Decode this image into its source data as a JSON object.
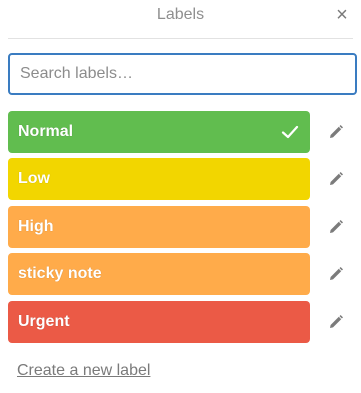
{
  "header": {
    "title": "Labels",
    "close_glyph": "×"
  },
  "search": {
    "placeholder": "Search labels…",
    "value": ""
  },
  "labels": [
    {
      "name": "Normal",
      "color": "#61bd4f",
      "selected": true
    },
    {
      "name": "Low",
      "color": "#f2d600",
      "selected": false
    },
    {
      "name": "High",
      "color": "#ffab4a",
      "selected": false
    },
    {
      "name": "sticky note",
      "color": "#ffab4a",
      "selected": false
    },
    {
      "name": "Urgent",
      "color": "#eb5a46",
      "selected": false
    }
  ],
  "icons": {
    "selected": "check-icon",
    "edit": "pencil-icon",
    "close": "close-icon"
  },
  "footer": {
    "create_label": "Create a new label"
  }
}
